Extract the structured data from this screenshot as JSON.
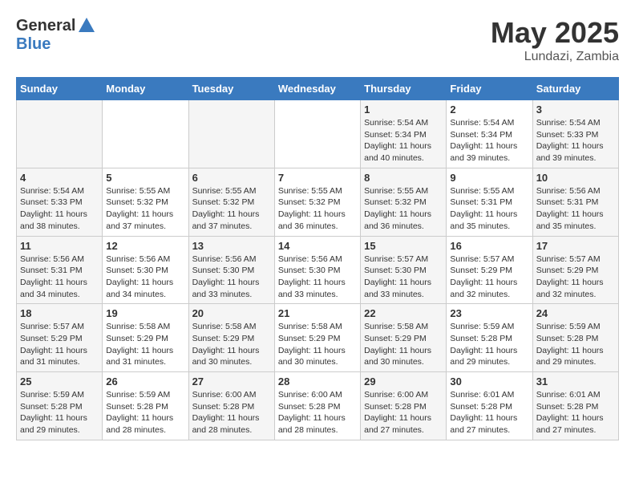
{
  "header": {
    "logo_general": "General",
    "logo_blue": "Blue",
    "title": "May 2025",
    "location": "Lundazi, Zambia"
  },
  "days_of_week": [
    "Sunday",
    "Monday",
    "Tuesday",
    "Wednesday",
    "Thursday",
    "Friday",
    "Saturday"
  ],
  "weeks": [
    [
      {
        "num": "",
        "sunrise": "",
        "sunset": "",
        "daylight": ""
      },
      {
        "num": "",
        "sunrise": "",
        "sunset": "",
        "daylight": ""
      },
      {
        "num": "",
        "sunrise": "",
        "sunset": "",
        "daylight": ""
      },
      {
        "num": "",
        "sunrise": "",
        "sunset": "",
        "daylight": ""
      },
      {
        "num": "1",
        "sunrise": "Sunrise: 5:54 AM",
        "sunset": "Sunset: 5:34 PM",
        "daylight": "Daylight: 11 hours and 40 minutes."
      },
      {
        "num": "2",
        "sunrise": "Sunrise: 5:54 AM",
        "sunset": "Sunset: 5:34 PM",
        "daylight": "Daylight: 11 hours and 39 minutes."
      },
      {
        "num": "3",
        "sunrise": "Sunrise: 5:54 AM",
        "sunset": "Sunset: 5:33 PM",
        "daylight": "Daylight: 11 hours and 39 minutes."
      }
    ],
    [
      {
        "num": "4",
        "sunrise": "Sunrise: 5:54 AM",
        "sunset": "Sunset: 5:33 PM",
        "daylight": "Daylight: 11 hours and 38 minutes."
      },
      {
        "num": "5",
        "sunrise": "Sunrise: 5:55 AM",
        "sunset": "Sunset: 5:32 PM",
        "daylight": "Daylight: 11 hours and 37 minutes."
      },
      {
        "num": "6",
        "sunrise": "Sunrise: 5:55 AM",
        "sunset": "Sunset: 5:32 PM",
        "daylight": "Daylight: 11 hours and 37 minutes."
      },
      {
        "num": "7",
        "sunrise": "Sunrise: 5:55 AM",
        "sunset": "Sunset: 5:32 PM",
        "daylight": "Daylight: 11 hours and 36 minutes."
      },
      {
        "num": "8",
        "sunrise": "Sunrise: 5:55 AM",
        "sunset": "Sunset: 5:32 PM",
        "daylight": "Daylight: 11 hours and 36 minutes."
      },
      {
        "num": "9",
        "sunrise": "Sunrise: 5:55 AM",
        "sunset": "Sunset: 5:31 PM",
        "daylight": "Daylight: 11 hours and 35 minutes."
      },
      {
        "num": "10",
        "sunrise": "Sunrise: 5:56 AM",
        "sunset": "Sunset: 5:31 PM",
        "daylight": "Daylight: 11 hours and 35 minutes."
      }
    ],
    [
      {
        "num": "11",
        "sunrise": "Sunrise: 5:56 AM",
        "sunset": "Sunset: 5:31 PM",
        "daylight": "Daylight: 11 hours and 34 minutes."
      },
      {
        "num": "12",
        "sunrise": "Sunrise: 5:56 AM",
        "sunset": "Sunset: 5:30 PM",
        "daylight": "Daylight: 11 hours and 34 minutes."
      },
      {
        "num": "13",
        "sunrise": "Sunrise: 5:56 AM",
        "sunset": "Sunset: 5:30 PM",
        "daylight": "Daylight: 11 hours and 33 minutes."
      },
      {
        "num": "14",
        "sunrise": "Sunrise: 5:56 AM",
        "sunset": "Sunset: 5:30 PM",
        "daylight": "Daylight: 11 hours and 33 minutes."
      },
      {
        "num": "15",
        "sunrise": "Sunrise: 5:57 AM",
        "sunset": "Sunset: 5:30 PM",
        "daylight": "Daylight: 11 hours and 33 minutes."
      },
      {
        "num": "16",
        "sunrise": "Sunrise: 5:57 AM",
        "sunset": "Sunset: 5:29 PM",
        "daylight": "Daylight: 11 hours and 32 minutes."
      },
      {
        "num": "17",
        "sunrise": "Sunrise: 5:57 AM",
        "sunset": "Sunset: 5:29 PM",
        "daylight": "Daylight: 11 hours and 32 minutes."
      }
    ],
    [
      {
        "num": "18",
        "sunrise": "Sunrise: 5:57 AM",
        "sunset": "Sunset: 5:29 PM",
        "daylight": "Daylight: 11 hours and 31 minutes."
      },
      {
        "num": "19",
        "sunrise": "Sunrise: 5:58 AM",
        "sunset": "Sunset: 5:29 PM",
        "daylight": "Daylight: 11 hours and 31 minutes."
      },
      {
        "num": "20",
        "sunrise": "Sunrise: 5:58 AM",
        "sunset": "Sunset: 5:29 PM",
        "daylight": "Daylight: 11 hours and 30 minutes."
      },
      {
        "num": "21",
        "sunrise": "Sunrise: 5:58 AM",
        "sunset": "Sunset: 5:29 PM",
        "daylight": "Daylight: 11 hours and 30 minutes."
      },
      {
        "num": "22",
        "sunrise": "Sunrise: 5:58 AM",
        "sunset": "Sunset: 5:29 PM",
        "daylight": "Daylight: 11 hours and 30 minutes."
      },
      {
        "num": "23",
        "sunrise": "Sunrise: 5:59 AM",
        "sunset": "Sunset: 5:28 PM",
        "daylight": "Daylight: 11 hours and 29 minutes."
      },
      {
        "num": "24",
        "sunrise": "Sunrise: 5:59 AM",
        "sunset": "Sunset: 5:28 PM",
        "daylight": "Daylight: 11 hours and 29 minutes."
      }
    ],
    [
      {
        "num": "25",
        "sunrise": "Sunrise: 5:59 AM",
        "sunset": "Sunset: 5:28 PM",
        "daylight": "Daylight: 11 hours and 29 minutes."
      },
      {
        "num": "26",
        "sunrise": "Sunrise: 5:59 AM",
        "sunset": "Sunset: 5:28 PM",
        "daylight": "Daylight: 11 hours and 28 minutes."
      },
      {
        "num": "27",
        "sunrise": "Sunrise: 6:00 AM",
        "sunset": "Sunset: 5:28 PM",
        "daylight": "Daylight: 11 hours and 28 minutes."
      },
      {
        "num": "28",
        "sunrise": "Sunrise: 6:00 AM",
        "sunset": "Sunset: 5:28 PM",
        "daylight": "Daylight: 11 hours and 28 minutes."
      },
      {
        "num": "29",
        "sunrise": "Sunrise: 6:00 AM",
        "sunset": "Sunset: 5:28 PM",
        "daylight": "Daylight: 11 hours and 27 minutes."
      },
      {
        "num": "30",
        "sunrise": "Sunrise: 6:01 AM",
        "sunset": "Sunset: 5:28 PM",
        "daylight": "Daylight: 11 hours and 27 minutes."
      },
      {
        "num": "31",
        "sunrise": "Sunrise: 6:01 AM",
        "sunset": "Sunset: 5:28 PM",
        "daylight": "Daylight: 11 hours and 27 minutes."
      }
    ]
  ]
}
